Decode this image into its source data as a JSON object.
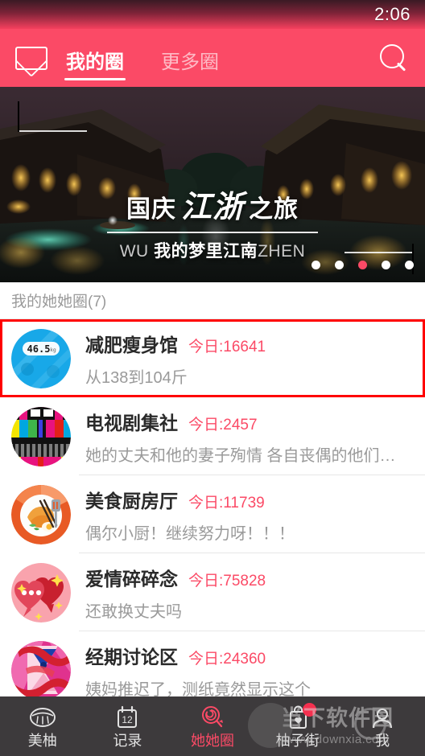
{
  "status_bar": {
    "time": "2:06"
  },
  "app_bar": {
    "mail_icon": "envelope-icon",
    "search_icon": "search-icon",
    "tabs": [
      {
        "label": "我的圈",
        "active": true
      },
      {
        "label": "更多圈",
        "active": false
      }
    ]
  },
  "banner": {
    "title_prefix": "国庆",
    "title_calligraphy": "江浙",
    "title_suffix": "之旅",
    "subtitle_left": "WU",
    "subtitle_center": "我的梦里江南",
    "subtitle_right": "ZHEN",
    "dots_total": 5,
    "dots_active_index": 2,
    "dot_active_color": "#fb4a66"
  },
  "section": {
    "title": "我的她她圈(7)"
  },
  "list": {
    "items": [
      {
        "title": "减肥瘦身馆",
        "count_label": "今日:16641",
        "subtitle": "从138到104斤",
        "icon": "weight-scale-icon",
        "scale_value": "46.5",
        "scale_unit": "kg",
        "selected": true
      },
      {
        "title": "电视剧集社",
        "count_label": "今日:2457",
        "subtitle": "她的丈夫和他的妻子殉情 各自丧偶的他们…",
        "icon": "tv-test-pattern-icon",
        "selected": false
      },
      {
        "title": "美食厨房厅",
        "count_label": "今日:11739",
        "subtitle": "偶尔小厨！继续努力呀！！！",
        "icon": "food-plate-icon",
        "selected": false
      },
      {
        "title": "爱情碎碎念",
        "count_label": "今日:75828",
        "subtitle": "还敢换丈夫吗",
        "icon": "heart-chat-icon",
        "selected": false
      },
      {
        "title": "经期讨论区",
        "count_label": "今日:24360",
        "subtitle": "姨妈推迟了，测纸竟然显示这个",
        "icon": "hourglass-icon",
        "selected": false
      }
    ]
  },
  "bottom_nav": {
    "items": [
      {
        "label": "美柚",
        "icon": "pomelo-slice-icon",
        "active": false,
        "badge": false
      },
      {
        "label": "记录",
        "icon": "calendar-icon",
        "active": false,
        "badge": false,
        "calendar_day": "12"
      },
      {
        "label": "她她圈",
        "icon": "lollipop-icon",
        "active": true,
        "badge": false
      },
      {
        "label": "柚子街",
        "icon": "shopping-bag-icon",
        "active": false,
        "badge": true
      },
      {
        "label": "我",
        "icon": "person-icon",
        "active": false,
        "badge": false
      }
    ],
    "active_color": "#fb4a66"
  },
  "watermark": {
    "text": "当下软件园",
    "url": "www.downxia.com"
  }
}
